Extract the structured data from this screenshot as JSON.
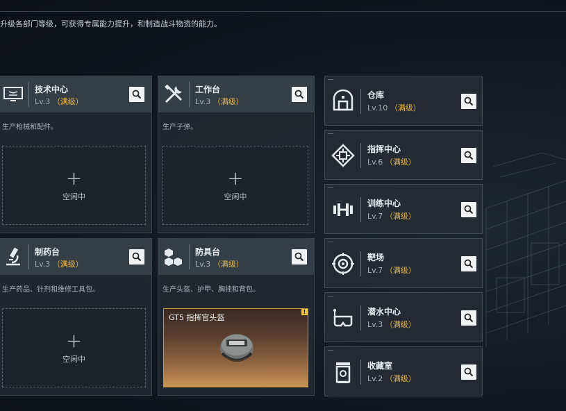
{
  "header": {
    "description": "升级各部门等级，可获得专属能力提升，和制造战斗物资的能力。"
  },
  "colors": {
    "accent_maxed": "#e8b84a",
    "panel_bg": "#22282f",
    "product_border": "#c79a45"
  },
  "panels": [
    {
      "title": "技术中心",
      "level": "Lv.3",
      "maxed": "（满级）",
      "icon": "computer-icon",
      "description": "生产枪械和配件。",
      "slot": {
        "plus": "+",
        "label": "空闲中"
      }
    },
    {
      "title": "工作台",
      "level": "Lv.3",
      "maxed": "（满级）",
      "icon": "tools-icon",
      "description": "生产子弹。",
      "slot": {
        "plus": "+",
        "label": "空闲中"
      }
    },
    {
      "title": "制药台",
      "level": "Lv.3",
      "maxed": "（满级）",
      "icon": "microscope-icon",
      "description": "生产药品、针剂和维修工具包。",
      "slot": {
        "plus": "+",
        "label": "空闲中"
      }
    },
    {
      "title": "防具台",
      "level": "Lv.3",
      "maxed": "（满级）",
      "icon": "cubes-icon",
      "description": "生产头盔、护甲、胸挂和背包。",
      "product": {
        "name": "GT5 指挥官头盔",
        "badge": "!",
        "icon": "helmet-icon"
      }
    }
  ],
  "side_panels": [
    {
      "title": "仓库",
      "level": "Lv.10",
      "maxed": "（满级）",
      "icon": "warehouse-icon"
    },
    {
      "title": "指挥中心",
      "level": "Lv.6",
      "maxed": "（满级）",
      "icon": "command-icon"
    },
    {
      "title": "训练中心",
      "level": "Lv.7",
      "maxed": "（满级）",
      "icon": "dumbbell-icon"
    },
    {
      "title": "靶场",
      "level": "Lv.7",
      "maxed": "（满级）",
      "icon": "target-icon"
    },
    {
      "title": "潜水中心",
      "level": "Lv.3",
      "maxed": "（满级）",
      "icon": "diving-mask-icon"
    },
    {
      "title": "收藏室",
      "level": "Lv.2",
      "maxed": "（满级）",
      "icon": "collection-icon"
    }
  ]
}
